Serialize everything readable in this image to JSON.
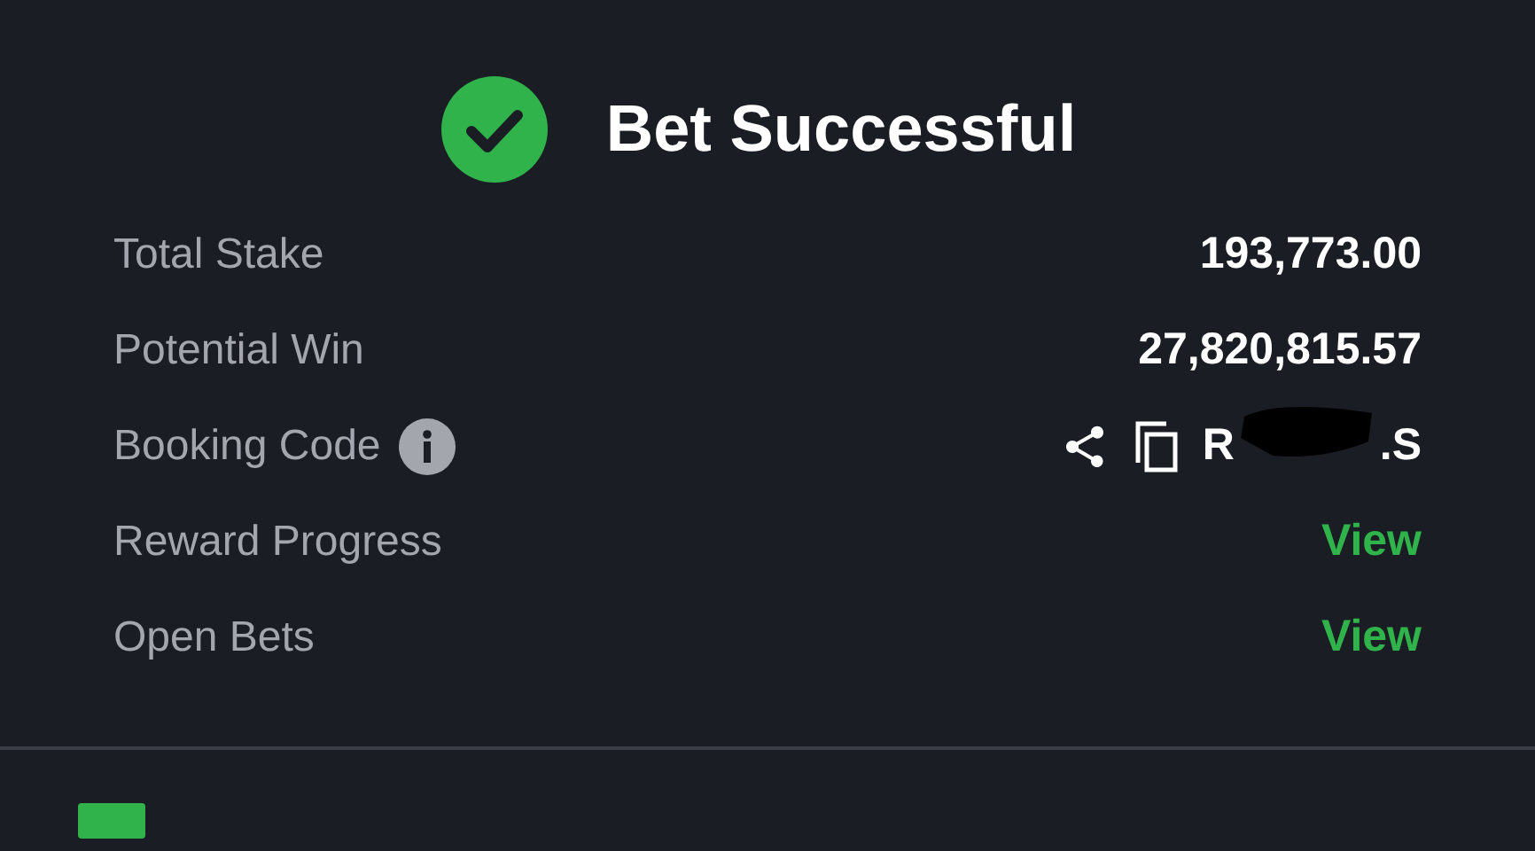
{
  "header": {
    "title": "Bet Successful"
  },
  "rows": [
    {
      "kind": "value",
      "label": "Total Stake",
      "value": "193,773.00"
    },
    {
      "kind": "value",
      "label": "Potential Win",
      "value": "27,820,815.57"
    },
    {
      "kind": "code",
      "label": "Booking Code",
      "code_start": "R",
      "code_end": ".S"
    },
    {
      "kind": "link",
      "label": "Reward Progress",
      "value": "View"
    },
    {
      "kind": "link",
      "label": "Open Bets",
      "value": "View"
    }
  ]
}
